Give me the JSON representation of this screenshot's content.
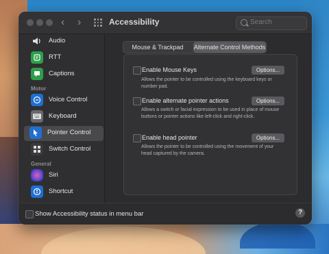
{
  "window": {
    "title": "Accessibility",
    "search_placeholder": "Search"
  },
  "sidebar": {
    "items": [
      {
        "label": "Audio",
        "icon": "speaker-icon",
        "color": "#2f2f31"
      },
      {
        "label": "RTT",
        "icon": "phone-icon",
        "color": "#2ca04a"
      },
      {
        "label": "Captions",
        "icon": "captions-icon",
        "color": "#2f9e4b"
      },
      {
        "label": "Voice Control",
        "icon": "voice-control-icon",
        "color": "#1f6fd1"
      },
      {
        "label": "Keyboard",
        "icon": "keyboard-icon",
        "color": "#6a6a6e"
      },
      {
        "label": "Pointer Control",
        "icon": "pointer-icon",
        "color": "#1f6fd1"
      },
      {
        "label": "Switch Control",
        "icon": "switch-control-icon",
        "color": "#3a3a3d"
      },
      {
        "label": "Siri",
        "icon": "siri-icon",
        "color": "#3b3bb4"
      },
      {
        "label": "Shortcut",
        "icon": "shortcut-icon",
        "color": "#1f6fd1"
      }
    ],
    "sections": {
      "motor": "Motor",
      "general": "General"
    }
  },
  "tabs": [
    "Mouse & Trackpad",
    "Alternate Control Methods"
  ],
  "options": [
    {
      "label": "Enable Mouse Keys",
      "desc": "Allows the pointer to be controlled using the keyboard keys or number pad.",
      "button": "Options..."
    },
    {
      "label": "Enable alternate pointer actions",
      "desc": "Allows a switch or facial expression to be used in place of mouse buttons or pointer actions like left-click and right-click.",
      "button": "Options..."
    },
    {
      "label": "Enable head pointer",
      "desc": "Allows the pointer to be controlled using the movement of your head captured by the camera.",
      "button": "Options..."
    }
  ],
  "footer": {
    "show_status": "Show Accessibility status in menu bar",
    "help": "?"
  }
}
